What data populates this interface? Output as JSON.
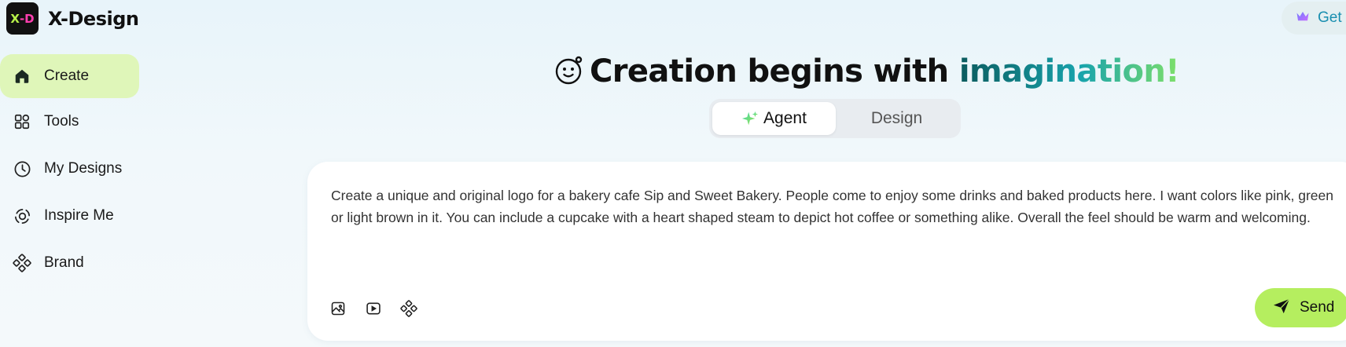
{
  "app": {
    "name": "X-Design",
    "logo_text_x": "X",
    "logo_text_d": "D"
  },
  "sidebar": {
    "items": [
      {
        "label": "Create",
        "icon": "home-icon",
        "active": true
      },
      {
        "label": "Tools",
        "icon": "grid-icon",
        "active": false
      },
      {
        "label": "My Designs",
        "icon": "clock-icon",
        "active": false
      },
      {
        "label": "Inspire Me",
        "icon": "inspire-icon",
        "active": false
      },
      {
        "label": "Brand",
        "icon": "brand-icon",
        "active": false
      }
    ]
  },
  "header": {
    "get_button_label": "Get",
    "get_button_icon": "crown-icon"
  },
  "hero": {
    "title_main": "Creation begins with ",
    "title_accent": "imagination!",
    "title_icon": "smiley-icon"
  },
  "mode_toggle": {
    "tabs": [
      {
        "label": "Agent",
        "selected": true,
        "icon": "sparkle-icon"
      },
      {
        "label": "Design",
        "selected": false
      }
    ]
  },
  "prompt": {
    "text": "Create a unique and original logo for a bakery cafe Sip and Sweet Bakery. People come to enjoy some drinks and baked products here. I want colors like pink, green or light brown in it. You can include a cupcake with a heart shaped steam to depict hot coffee or something alike. Overall the feel should be warm and welcoming.",
    "tool_icons": [
      "image-upload-icon",
      "video-icon",
      "brand-kit-icon"
    ],
    "send_label": "Send",
    "send_icon": "paper-plane-icon"
  },
  "colors": {
    "accent_green": "#b5ee5f",
    "active_nav_bg": "#dff6b9",
    "gradient_start": "#0b5b5e",
    "gradient_end": "#7fe06a"
  }
}
